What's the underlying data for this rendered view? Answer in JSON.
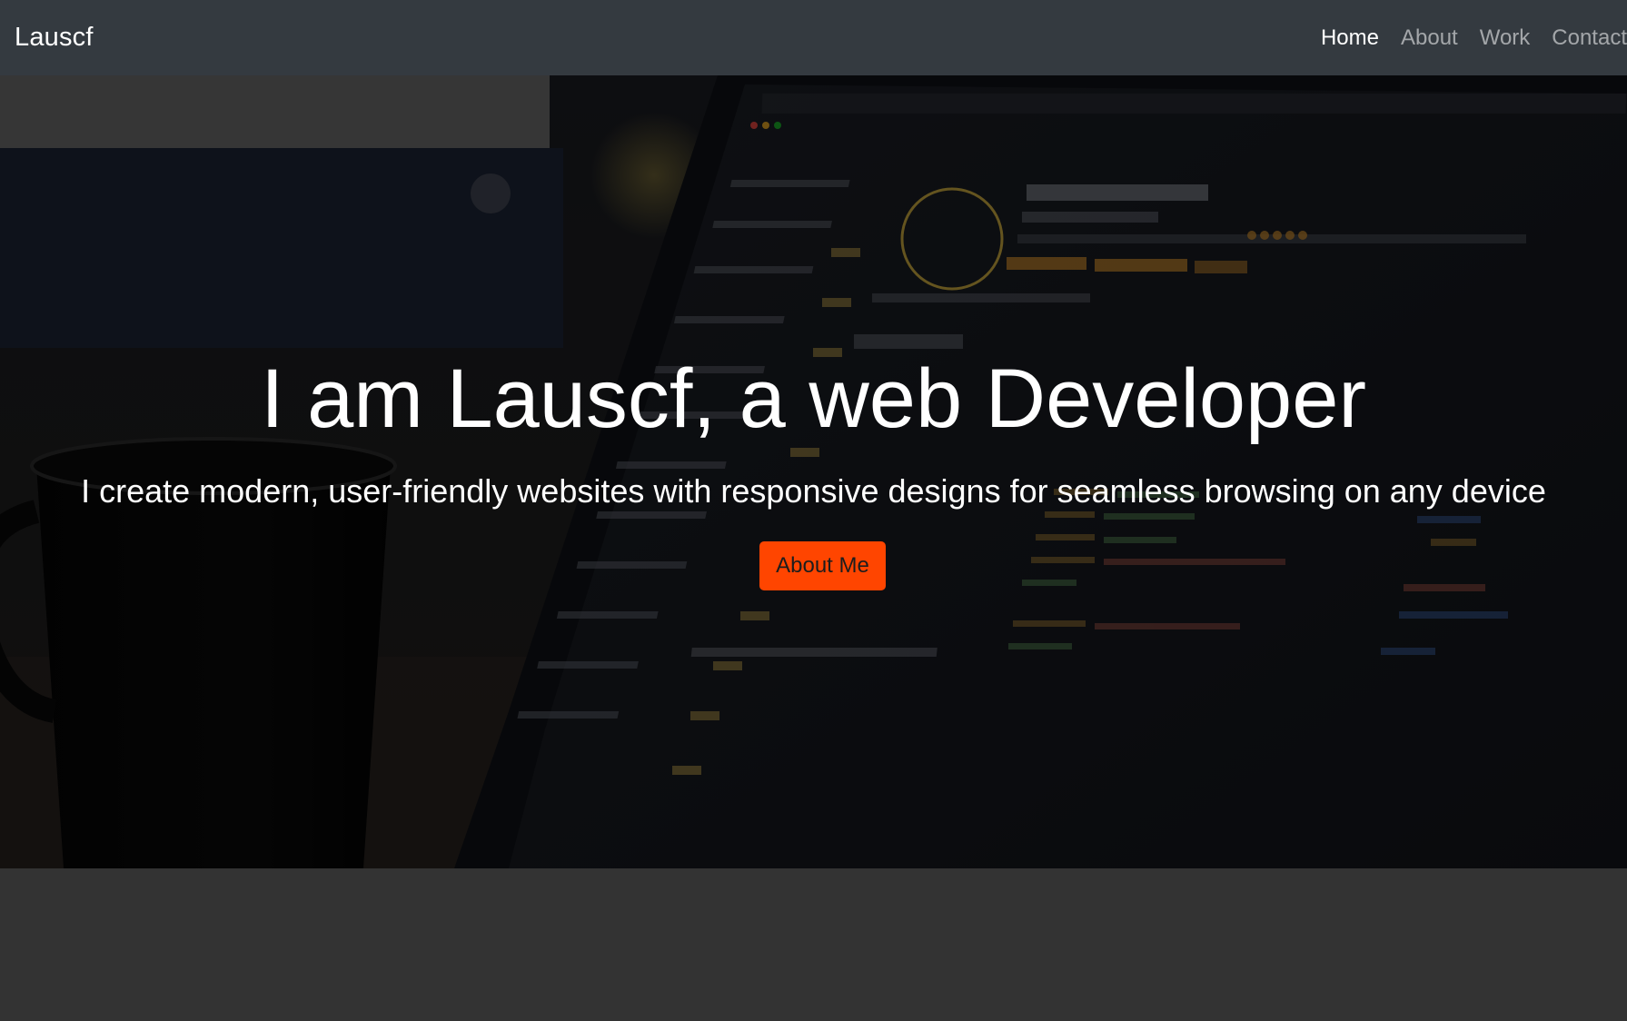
{
  "nav": {
    "brand": "Lauscf",
    "links": [
      "Home",
      "About",
      "Work",
      "Contact"
    ],
    "active": "Home"
  },
  "hero": {
    "title": "I am Lauscf, a web Developer",
    "subtitle": "I create modern, user-friendly websites with responsive designs for seamless browsing on any device",
    "button_label": "About Me",
    "background_image": "laptop-code-editor-photo"
  },
  "colors": {
    "navbar": "#343a40",
    "accent": "#ff4500",
    "page_background": "#333333",
    "text": "#ffffff"
  }
}
